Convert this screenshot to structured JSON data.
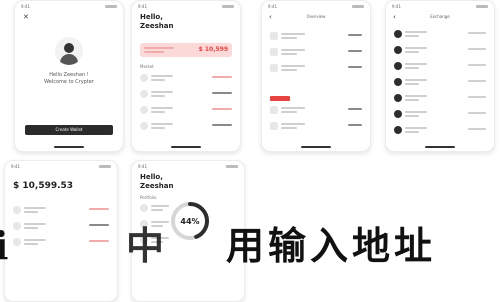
{
  "screens": {
    "welcome": {
      "title": "Hello Zeeshan !",
      "subtitle": "Welcome to Crypter",
      "button_label": "Create Wallet"
    },
    "home": {
      "greeting": "Hello,",
      "name": "Zeeshan",
      "balance_banner": "$ 10,599",
      "section": "Market"
    },
    "detail": {
      "title": "Overview"
    },
    "exchange": {
      "title": "Exchange"
    },
    "wallet": {
      "balance": "$ 10,599.53"
    },
    "portfolio": {
      "greeting": "Hello,",
      "name": "Zeeshan",
      "section": "Portfolio",
      "percent": "44%"
    }
  },
  "overlay_text": {
    "left_fragment": "i",
    "middle_fragment": "中",
    "right_phrase": "用输入地址"
  },
  "colors": {
    "accent_red": "#e9433f",
    "banner_pink": "#fbd9d9",
    "dark": "#2d2d2d",
    "ring_gray": "#d6d6d6"
  },
  "icons": [
    "close-icon",
    "avatar-icon",
    "back-icon",
    "coin-icon",
    "chart-ring-icon"
  ],
  "portfolio_ring_fraction": 0.44
}
